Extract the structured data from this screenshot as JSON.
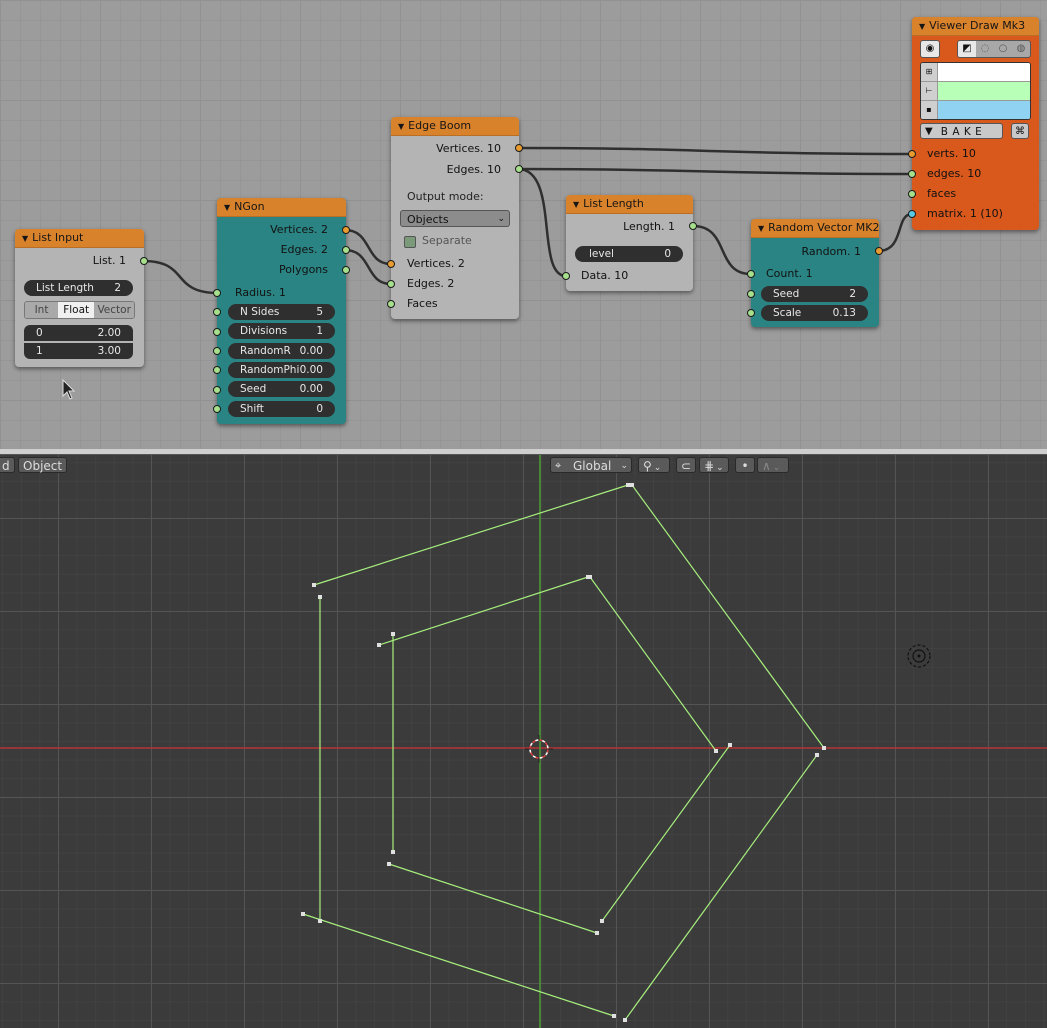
{
  "node_editor": {
    "list_input": {
      "title": "List Input",
      "output": "List. 1",
      "list_length_label": "List Length",
      "list_length_value": "2",
      "modes": [
        "Int",
        "Float",
        "Vector"
      ],
      "active_mode": "Float",
      "items": [
        {
          "index": "0",
          "value": "2.00"
        },
        {
          "index": "1",
          "value": "3.00"
        }
      ]
    },
    "ngon": {
      "title": "NGon",
      "outputs": [
        "Vertices. 2",
        "Edges. 2",
        "Polygons"
      ],
      "radius_input": "Radius. 1",
      "fields": [
        {
          "label": "N Sides",
          "value": "5"
        },
        {
          "label": "Divisions",
          "value": "1"
        },
        {
          "label": "RandomR",
          "value": "0.00"
        },
        {
          "label": "RandomPhi",
          "value": "0.00"
        },
        {
          "label": "Seed",
          "value": "0.00"
        },
        {
          "label": "Shift",
          "value": "0"
        }
      ]
    },
    "edge_boom": {
      "title": "Edge Boom",
      "outputs": [
        "Vertices. 10",
        "Edges. 10"
      ],
      "output_mode_label": "Output mode:",
      "output_mode_value": "Objects",
      "separate_label": "Separate",
      "separate_checked": false,
      "inputs": [
        "Vertices. 2",
        "Edges. 2",
        "Faces"
      ]
    },
    "list_length": {
      "title": "List Length",
      "output": "Length. 1",
      "level_label": "level",
      "level_value": "0",
      "input": "Data. 10"
    },
    "random_vector": {
      "title": "Random Vector MK2",
      "output": "Random. 1",
      "input": "Count. 1",
      "fields": [
        {
          "label": "Seed",
          "value": "2"
        },
        {
          "label": "Scale",
          "value": "0.13"
        }
      ]
    },
    "viewer_draw": {
      "title": "Viewer Draw Mk3",
      "bake_label": "B A K E",
      "inputs": [
        "verts. 10",
        "edges. 10",
        "faces",
        "matrix. 1 (10)"
      ],
      "color_swatches": [
        "#ffffff",
        "#b8ffb8",
        "#8fd2f2"
      ]
    }
  },
  "viewport": {
    "header": {
      "partial_menu": "d",
      "mode": "Object",
      "orientation": "Global"
    },
    "colors": {
      "wire": "#a6ef7d",
      "x_axis": "#b53434",
      "y_axis": "#4c9e34",
      "vertex": "#e0e0e0"
    },
    "outer_polygons_note": ""
  }
}
